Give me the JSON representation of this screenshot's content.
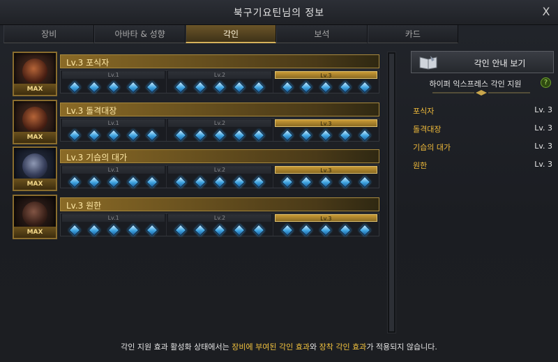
{
  "window": {
    "title": "북구기요틴님의 정보",
    "close": "X"
  },
  "tabs": [
    {
      "label": "장비",
      "active": false
    },
    {
      "label": "아바타 & 성향",
      "active": false
    },
    {
      "label": "각인",
      "active": true
    },
    {
      "label": "보석",
      "active": false
    },
    {
      "label": "카드",
      "active": false
    }
  ],
  "engravings": [
    {
      "title": "Lv.3 포식자",
      "max": "MAX",
      "levels": [
        "Lv.1",
        "Lv.2",
        "Lv.3"
      ],
      "active_level": 3,
      "gems_per_level": 5
    },
    {
      "title": "Lv.3 돌격대장",
      "max": "MAX",
      "levels": [
        "Lv.1",
        "Lv.2",
        "Lv.3"
      ],
      "active_level": 3,
      "gems_per_level": 5
    },
    {
      "title": "Lv.3 기습의 대가",
      "max": "MAX",
      "levels": [
        "Lv.1",
        "Lv.2",
        "Lv.3"
      ],
      "active_level": 3,
      "gems_per_level": 5
    },
    {
      "title": "Lv.3 원한",
      "max": "MAX",
      "levels": [
        "Lv.1",
        "Lv.2",
        "Lv.3"
      ],
      "active_level": 3,
      "gems_per_level": 5
    }
  ],
  "side": {
    "guide_button": "각인 안내 보기",
    "support_label": "하이퍼 익스프레스 각인 지원",
    "help": "?",
    "summary": [
      {
        "name": "포식자",
        "level": "Lv. 3"
      },
      {
        "name": "돌격대장",
        "level": "Lv. 3"
      },
      {
        "name": "기습의 대가",
        "level": "Lv. 3"
      },
      {
        "name": "원한",
        "level": "Lv. 3"
      }
    ]
  },
  "footer": {
    "part1": "각인 지원 효과 활성화 상태에서는 ",
    "highlight1": "장비에 부여된 각인 효과",
    "part2": "와 ",
    "highlight2": "장착 각인 효과",
    "part3": "가 적용되지 않습니다."
  },
  "colors": {
    "accent": "#f1bb3a",
    "gem": "#3ea3e0",
    "active_tab": "#6b5528"
  }
}
